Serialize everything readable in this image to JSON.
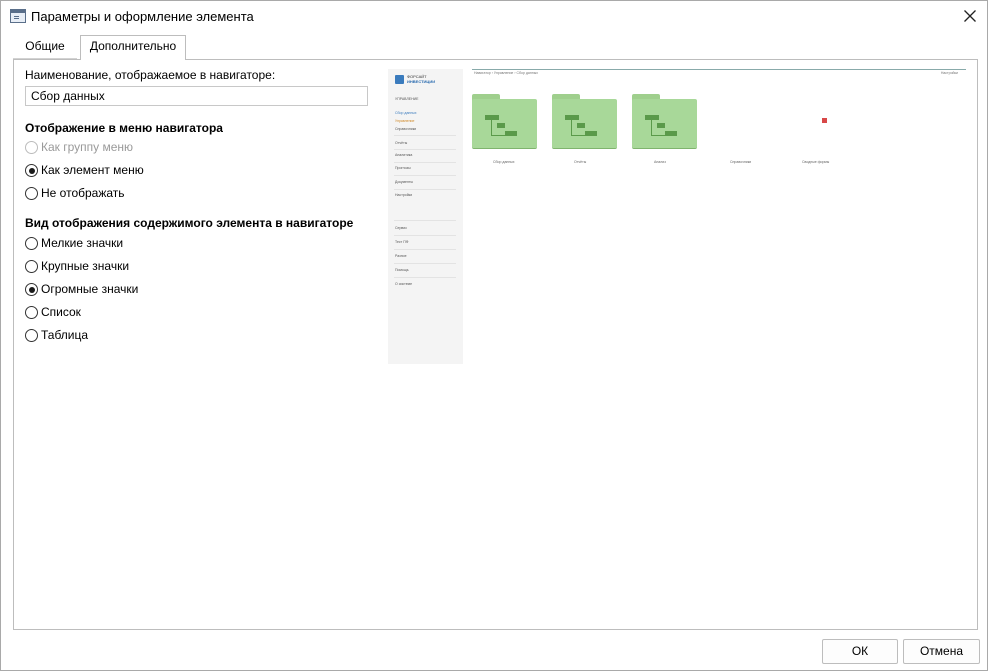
{
  "window": {
    "title": "Параметры и оформление элемента",
    "icon": "window-properties-icon",
    "close_icon": "close-icon"
  },
  "tabs": [
    {
      "label": "Общие",
      "active": false
    },
    {
      "label": "Дополнительно",
      "active": true
    }
  ],
  "name_field": {
    "label": "Наименование, отображаемое в навигаторе:",
    "value": "Сбор данных"
  },
  "menu_display": {
    "heading": "Отображение в меню навигатора",
    "options": [
      {
        "label": "Как группу меню",
        "checked": false,
        "disabled": true
      },
      {
        "label": "Как элемент меню",
        "checked": true,
        "disabled": false
      },
      {
        "label": "Не отображать",
        "checked": false,
        "disabled": false
      }
    ]
  },
  "content_view": {
    "heading": "Вид отображения содержимого элемента в навигаторе",
    "options": [
      {
        "label": "Мелкие значки",
        "checked": false
      },
      {
        "label": "Крупные значки",
        "checked": false
      },
      {
        "label": "Огромные значки",
        "checked": true
      },
      {
        "label": "Список",
        "checked": false
      },
      {
        "label": "Таблица",
        "checked": false
      }
    ]
  },
  "preview": {
    "logo_line1": "ФОРСАЙТ",
    "logo_line2": "ИНВЕСТИЦИИ",
    "sidebar_items": [
      "УПРАВЛЕНИЕ",
      "Сбор данных",
      "Управление",
      "Справочники",
      "Отчёты",
      "Аналитика",
      "Прогнозы",
      "Документы",
      "Настройки",
      "Сервис",
      "Тест ПФ",
      "Разное",
      "Помощь",
      "О системе"
    ],
    "breadcrumb": "Навигатор › Управление › Сбор данных",
    "top_right": "Настройки",
    "folder_captions": [
      "Сбор данных",
      "Отчёты",
      "Анализ",
      "Справочники",
      "Сводные формы"
    ],
    "folder_color": "#a8d899"
  },
  "buttons": {
    "ok": "ОК",
    "cancel": "Отмена"
  }
}
